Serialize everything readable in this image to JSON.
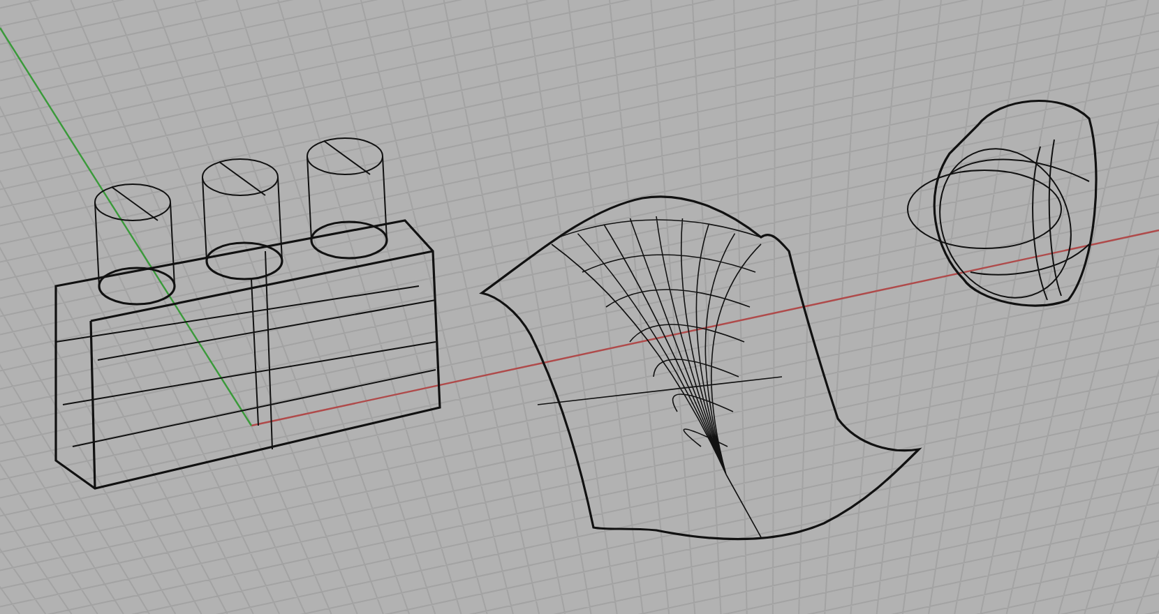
{
  "viewport": {
    "objects": [
      {
        "kind": "box"
      },
      {
        "kind": "surface"
      },
      {
        "kind": "cage"
      }
    ]
  }
}
